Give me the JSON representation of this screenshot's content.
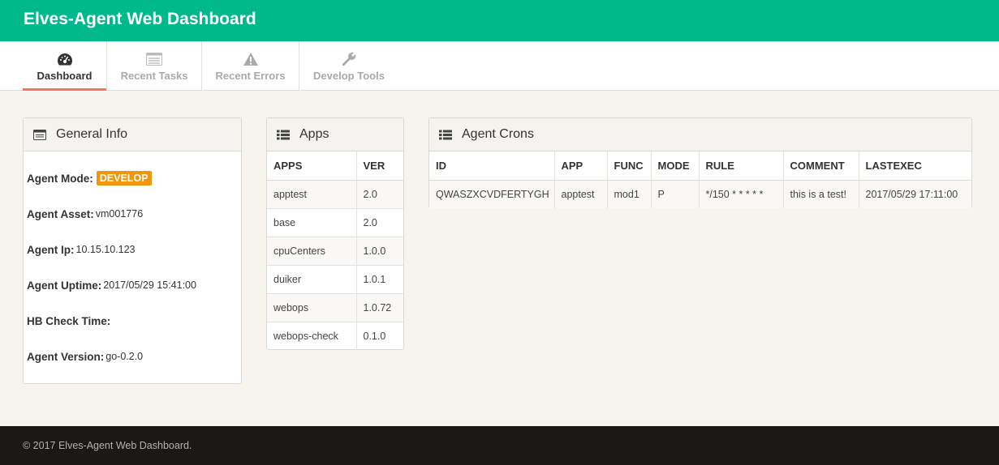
{
  "header": {
    "title": "Elves-Agent Web Dashboard"
  },
  "tabs": [
    {
      "label": "Dashboard",
      "icon": "dashboard-icon"
    },
    {
      "label": "Recent Tasks",
      "icon": "list-icon"
    },
    {
      "label": "Recent Errors",
      "icon": "warning-icon"
    },
    {
      "label": "Develop Tools",
      "icon": "wrench-icon"
    }
  ],
  "general": {
    "title": "General Info",
    "mode_label": "Agent Mode:",
    "mode_value": "DEVELOP",
    "asset_label": "Agent Asset:",
    "asset_value": "vm001776",
    "ip_label": "Agent Ip:",
    "ip_value": "10.15.10.123",
    "uptime_label": "Agent Uptime:",
    "uptime_value": "2017/05/29 15:41:00",
    "hb_label": "HB Check Time:",
    "hb_value": "",
    "version_label": "Agent Version:",
    "version_value": "go-0.2.0"
  },
  "apps": {
    "title": "Apps",
    "headers": [
      "APPS",
      "VER"
    ],
    "rows": [
      [
        "apptest",
        "2.0"
      ],
      [
        "base",
        "2.0"
      ],
      [
        "cpuCenters",
        "1.0.0"
      ],
      [
        "duiker",
        "1.0.1"
      ],
      [
        "webops",
        "1.0.72"
      ],
      [
        "webops-check",
        "0.1.0"
      ]
    ]
  },
  "crons": {
    "title": "Agent Crons",
    "headers": [
      "ID",
      "APP",
      "FUNC",
      "MODE",
      "RULE",
      "COMMENT",
      "LASTEXEC"
    ],
    "rows": [
      [
        "QWASZXCVDFERTYGH",
        "apptest",
        "mod1",
        "P",
        "*/150 * * * * *",
        "this is a test!",
        "2017/05/29 17:11:00"
      ]
    ]
  },
  "footer": {
    "text": "© 2017 Elves-Agent Web Dashboard."
  },
  "colors": {
    "brand": "#00b98a",
    "badge": "#f0950c",
    "tab_active": "#f07760",
    "footer": "#1b1918"
  }
}
